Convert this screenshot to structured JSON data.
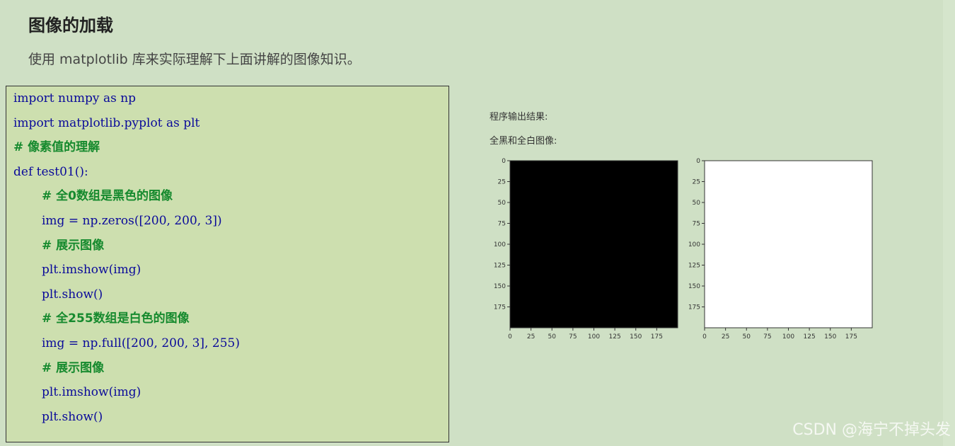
{
  "article": {
    "heading": "图像的加载",
    "intro": "使用 matplotlib 库来实际理解下上面讲解的图像知识。"
  },
  "code": {
    "lines": [
      {
        "text": "import numpy as np",
        "type": "code",
        "indent": 0
      },
      {
        "text": "import matplotlib.pyplot as plt",
        "type": "code",
        "indent": 0
      },
      {
        "text": "# 像素值的理解",
        "type": "comment",
        "indent": 0
      },
      {
        "text": "def test01():",
        "type": "code",
        "indent": 0
      },
      {
        "text": "# 全0数组是黑色的图像",
        "type": "comment",
        "indent": 1
      },
      {
        "text": "img = np.zeros([200, 200, 3])",
        "type": "code",
        "indent": 1
      },
      {
        "text": "# 展示图像",
        "type": "comment",
        "indent": 1
      },
      {
        "text": "plt.imshow(img)",
        "type": "code",
        "indent": 1
      },
      {
        "text": "plt.show()",
        "type": "code",
        "indent": 1
      },
      {
        "text": "# 全255数组是白色的图像",
        "type": "comment",
        "indent": 1
      },
      {
        "text": "img = np.full([200, 200, 3], 255)",
        "type": "code",
        "indent": 1
      },
      {
        "text": "# 展示图像",
        "type": "comment",
        "indent": 1
      },
      {
        "text": "plt.imshow(img)",
        "type": "code",
        "indent": 1
      },
      {
        "text": "plt.show()",
        "type": "code",
        "indent": 1
      }
    ]
  },
  "output": {
    "label": "程序输出结果:",
    "sublabel": "全黑和全白图像:"
  },
  "colors": {
    "code_bg": "#cddfaf",
    "code_text": "#0a0a9a",
    "comment_text": "#168a2e",
    "page_bg": "#cfe0c5"
  },
  "chart_data": [
    {
      "type": "heatmap",
      "image_fill": "#000000",
      "xlim": [
        0,
        200
      ],
      "ylim": [
        200,
        0
      ],
      "xticks": [
        0,
        25,
        50,
        75,
        100,
        125,
        150,
        175
      ],
      "yticks": [
        0,
        25,
        50,
        75,
        100,
        125,
        150,
        175
      ]
    },
    {
      "type": "heatmap",
      "image_fill": "#ffffff",
      "xlim": [
        0,
        200
      ],
      "ylim": [
        200,
        0
      ],
      "xticks": [
        0,
        25,
        50,
        75,
        100,
        125,
        150,
        175
      ],
      "yticks": [
        0,
        25,
        50,
        75,
        100,
        125,
        150,
        175
      ]
    }
  ],
  "watermark": "CSDN @海宁不掉头发"
}
